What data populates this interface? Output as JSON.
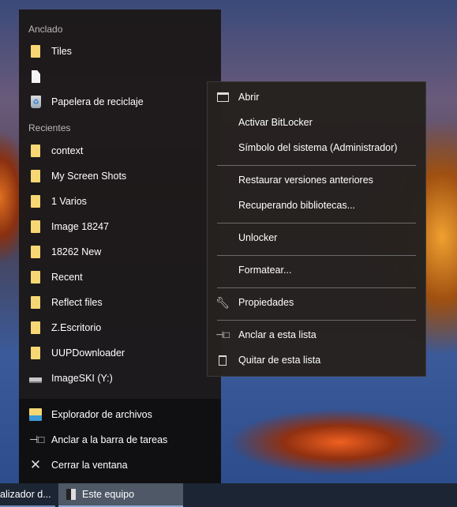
{
  "jumplist": {
    "pinned_header": "Anclado",
    "pinned": [
      {
        "label": "Tiles",
        "icon": "folder-icon"
      },
      {
        "label": "",
        "icon": "file-icon"
      },
      {
        "label": "Papelera de reciclaje",
        "icon": "recycle-bin-icon"
      }
    ],
    "recent_header": "Recientes",
    "recent": [
      {
        "label": "context",
        "icon": "folder-icon"
      },
      {
        "label": "My Screen Shots",
        "icon": "folder-icon"
      },
      {
        "label": "1 Varios",
        "icon": "folder-icon"
      },
      {
        "label": "Image 18247",
        "icon": "folder-icon"
      },
      {
        "label": "18262 New",
        "icon": "folder-icon"
      },
      {
        "label": "Recent",
        "icon": "folder-icon"
      },
      {
        "label": "Reflect files",
        "icon": "folder-icon"
      },
      {
        "label": "Z.Escritorio",
        "icon": "folder-icon"
      },
      {
        "label": "UUPDownloader",
        "icon": "folder-icon"
      },
      {
        "label": "ImageSKI (Y:)",
        "icon": "drive-icon"
      }
    ],
    "actions": [
      {
        "label": "Explorador de archivos",
        "icon": "file-explorer-icon"
      },
      {
        "label": "Anclar a la barra de tareas",
        "icon": "pin-icon"
      },
      {
        "label": "Cerrar la ventana",
        "icon": "close-icon"
      }
    ]
  },
  "context_menu": {
    "items": [
      "Abrir",
      "Activar BitLocker",
      "Símbolo del sistema (Administrador)",
      "Restaurar versiones anteriores",
      "Recuperando bibliotecas...",
      "Unlocker",
      "Formatear...",
      "Propiedades",
      "Anclar a esta lista",
      "Quitar de esta lista"
    ]
  },
  "taskbar": {
    "items": [
      {
        "label": "alizador d..."
      },
      {
        "label": "Este equipo",
        "active": true
      }
    ]
  },
  "colors": {
    "folder": "#f7d774",
    "taskbar": "#1c2533",
    "active_task": "#4e5866"
  }
}
